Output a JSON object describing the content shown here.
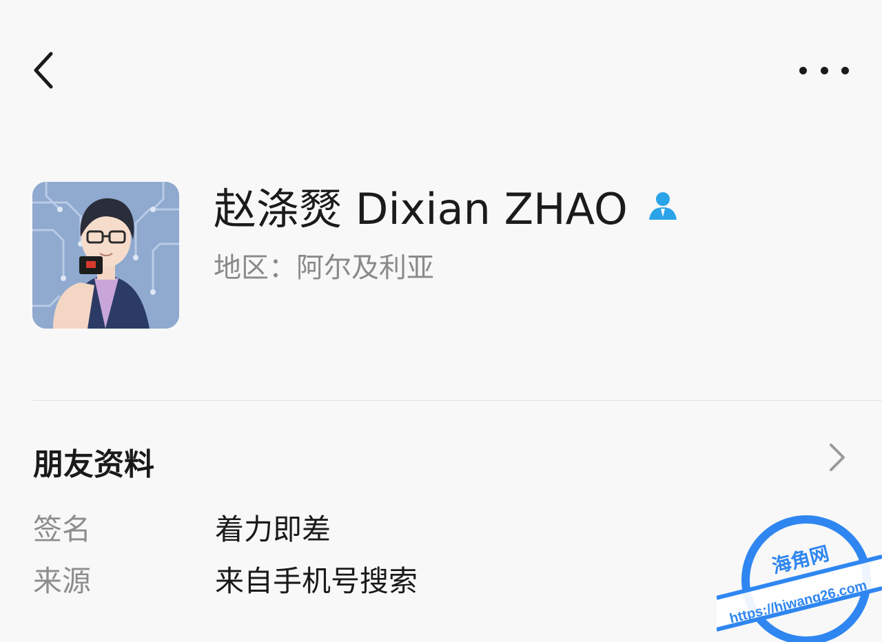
{
  "nav": {
    "back_icon": "chevron-left-icon",
    "more_icon": "more-horizontal-icon"
  },
  "profile": {
    "name": "赵涤燹 Dixian ZHAO",
    "badge_icon": "contact-person-icon",
    "badge_color": "#2aa3e8",
    "region": "地区：阿尔及利亚"
  },
  "friend_info": {
    "title": "朋友资料",
    "chevron_icon": "chevron-right-icon",
    "rows": [
      {
        "label": "签名",
        "value": "着力即差"
      },
      {
        "label": "来源",
        "value": "来自手机号搜索"
      }
    ]
  },
  "watermark": {
    "title": "海角网",
    "url": "https://hjwang26.com",
    "color": "#2f86f0"
  }
}
